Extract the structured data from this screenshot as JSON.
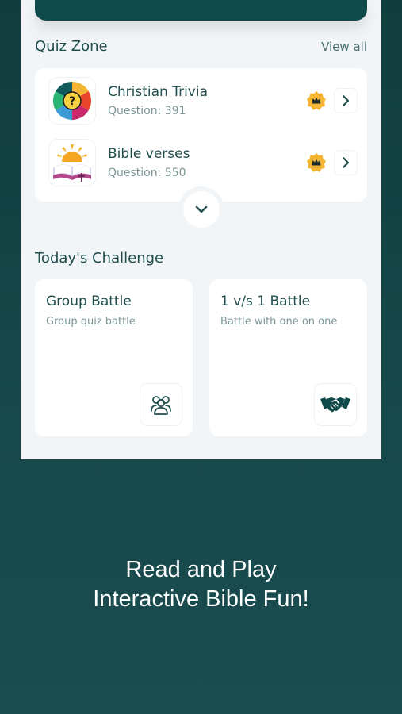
{
  "quiz_zone": {
    "title": "Quiz Zone",
    "view_all": "View all",
    "items": [
      {
        "name": "Christian Trivia",
        "subtitle": "Question: 391",
        "icon": "trivia-wheel-icon",
        "badge_icon": "crown-badge-icon"
      },
      {
        "name": "Bible verses",
        "subtitle": "Question: 550",
        "icon": "open-bible-sunrise-icon",
        "badge_icon": "crown-badge-icon"
      }
    ],
    "expand_icon": "chevron-down-icon"
  },
  "challenge": {
    "title": "Today's Challenge",
    "cards": [
      {
        "title": "Group Battle",
        "subtitle": "Group quiz battle",
        "icon": "group-people-icon"
      },
      {
        "title": "1 v/s 1 Battle",
        "subtitle": "Battle with one on one",
        "icon": "handshake-icon"
      }
    ]
  },
  "promo": {
    "line1": "Read and Play",
    "line2": "Interactive Bible Fun!"
  },
  "colors": {
    "background": "#17484a",
    "primary": "#0f4b4a",
    "text_dark": "#1f4e4d",
    "text_muted": "#7a9695",
    "badge": "#f4b533"
  }
}
